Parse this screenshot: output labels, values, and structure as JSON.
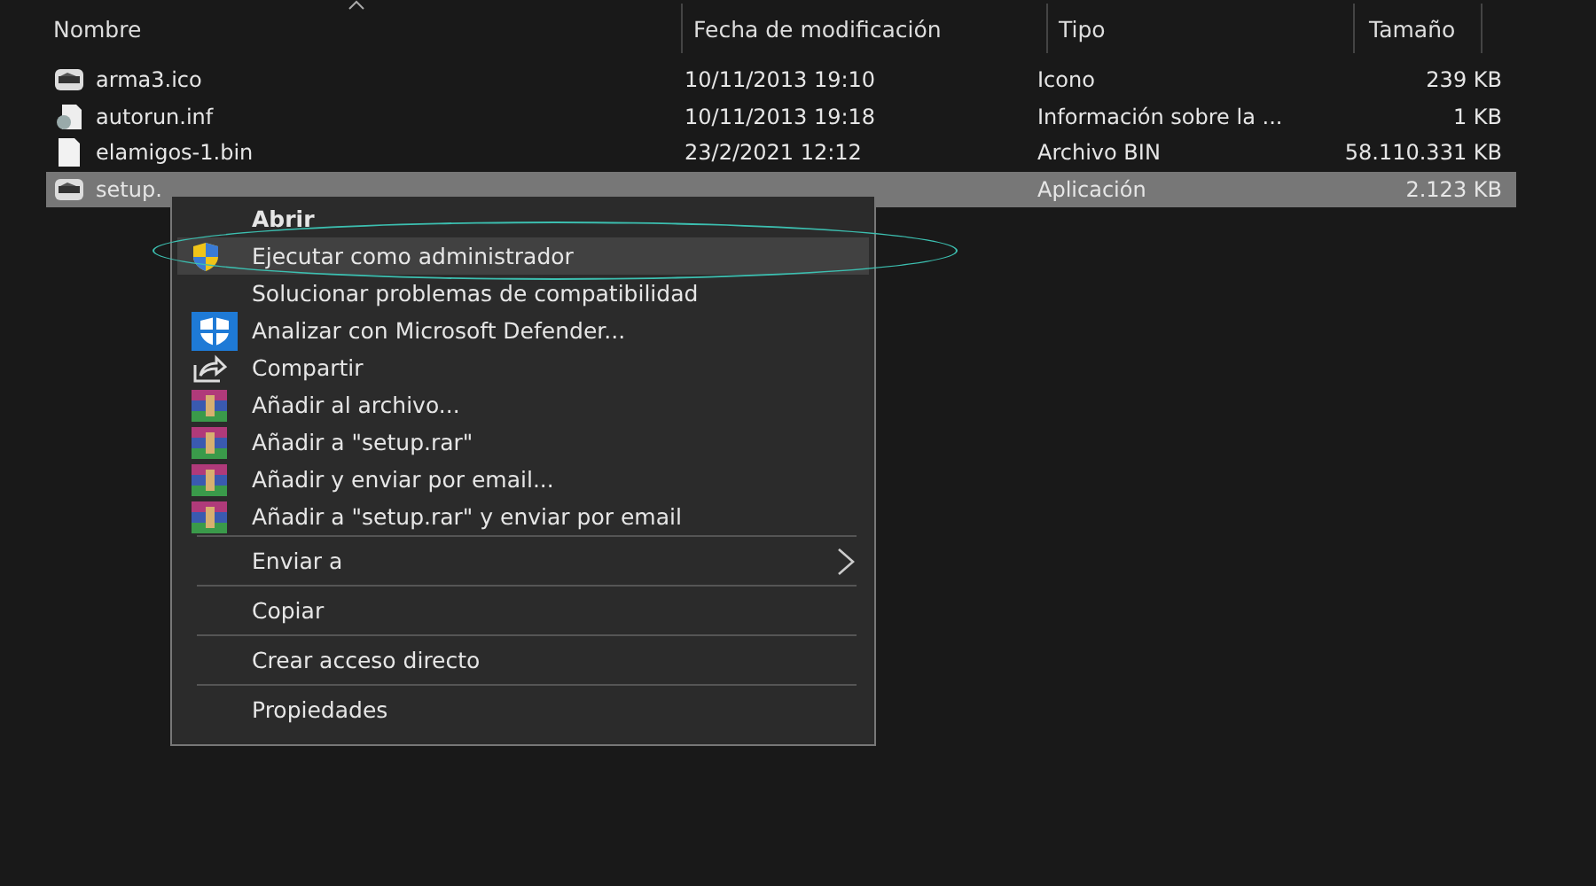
{
  "columns": [
    {
      "label": "Nombre",
      "sorted": true
    },
    {
      "label": "Fecha de modificación",
      "sorted": false
    },
    {
      "label": "Tipo",
      "sorted": false
    },
    {
      "label": "Tamaño",
      "sorted": false
    }
  ],
  "files": [
    {
      "kind": "app",
      "name": "arma3.ico",
      "date": "10/11/2013 19:10",
      "type": "Icono",
      "size": "239 KB",
      "selected": false
    },
    {
      "kind": "settings",
      "name": "autorun.inf",
      "date": "10/11/2013 19:18",
      "type": "Información sobre la ...",
      "size": "1 KB",
      "selected": false
    },
    {
      "kind": "file",
      "name": "elamigos-1.bin",
      "date": "23/2/2021 12:12",
      "type": "Archivo BIN",
      "size": "58.110.331 KB",
      "selected": false
    },
    {
      "kind": "app",
      "name": "setup.",
      "type": "Aplicación",
      "size": "2.123 KB",
      "selected": true
    }
  ],
  "context_menu": [
    {
      "kind": "plain",
      "label": "Abrir",
      "default": true,
      "selected": false
    },
    {
      "kind": "shield",
      "label": "Ejecutar como administrador",
      "default": false,
      "selected": true
    },
    {
      "kind": "plain",
      "label": "Solucionar problemas de compatibilidad",
      "default": false,
      "selected": false
    },
    {
      "kind": "defender",
      "label": "Analizar con Microsoft Defender...",
      "default": false,
      "selected": false
    },
    {
      "kind": "share",
      "label": "Compartir",
      "default": false,
      "selected": false
    },
    {
      "kind": "archive",
      "label": "Añadir al archivo...",
      "default": false,
      "selected": false
    },
    {
      "kind": "archive",
      "label": "Añadir a \"setup.rar\"",
      "default": false,
      "selected": false
    },
    {
      "kind": "archive",
      "label": "Añadir y enviar por email...",
      "default": false,
      "selected": false
    },
    {
      "kind": "archive",
      "label": "Añadir a \"setup.rar\" y enviar por email",
      "default": false,
      "selected": false
    },
    {
      "kind": "separator"
    },
    {
      "kind": "submenu",
      "label": "Enviar a",
      "default": false,
      "selected": false
    },
    {
      "kind": "separator"
    },
    {
      "kind": "plain",
      "label": "Copiar",
      "default": false,
      "selected": false
    },
    {
      "kind": "separator"
    },
    {
      "kind": "plain",
      "label": "Crear acceso directo",
      "default": false,
      "selected": false
    },
    {
      "kind": "separator"
    },
    {
      "kind": "plain",
      "label": "Propiedades",
      "default": false,
      "selected": false
    }
  ],
  "annotation": {
    "kind": "ellipse"
  }
}
